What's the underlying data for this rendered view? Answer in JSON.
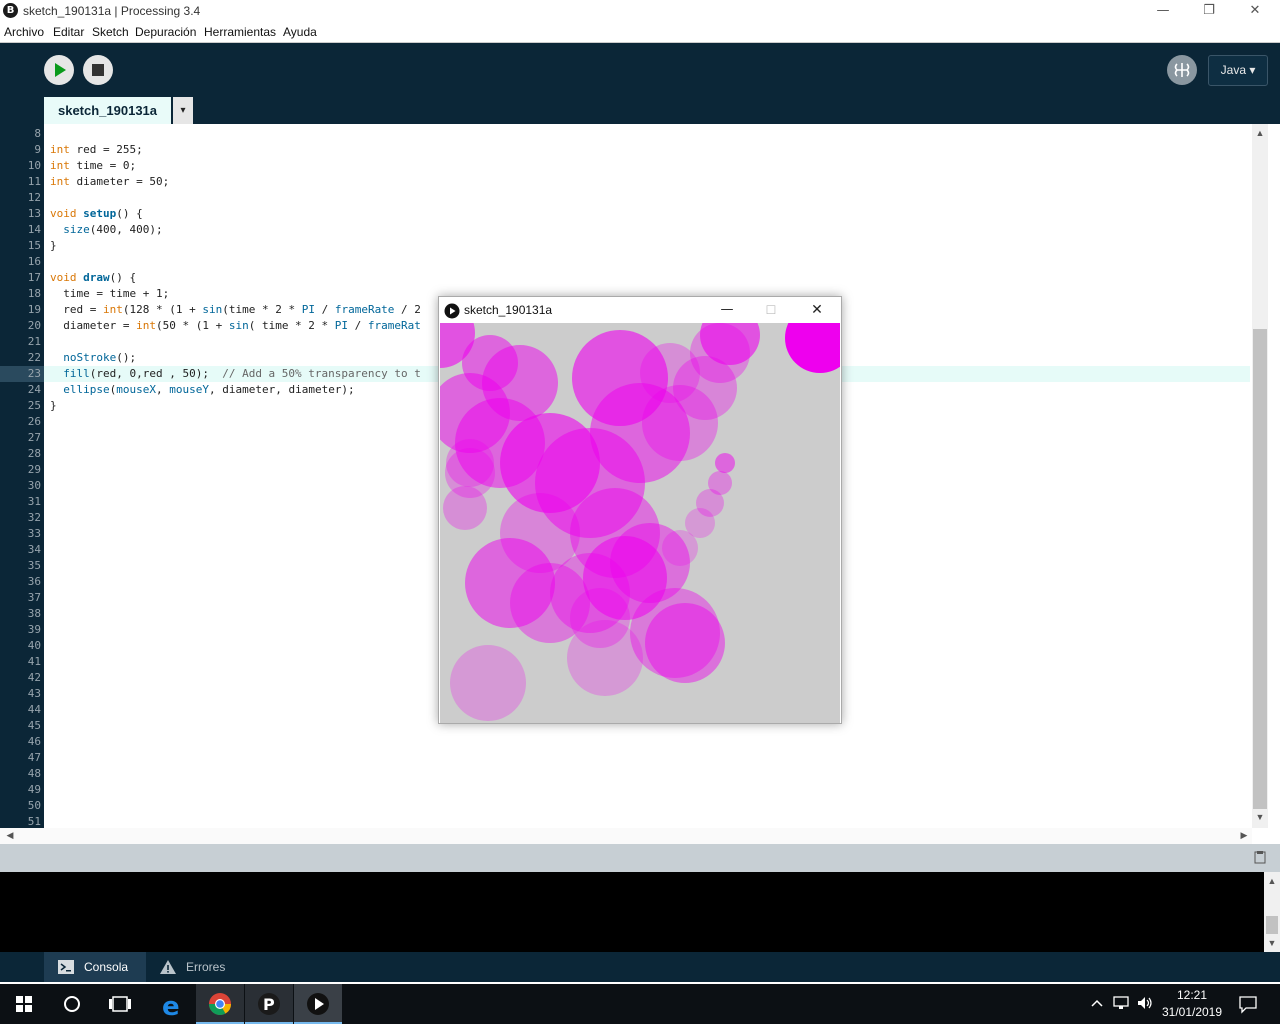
{
  "window": {
    "title": "sketch_190131a | Processing 3.4",
    "app_icon_glyph": "B"
  },
  "menu": {
    "items": [
      "Archivo",
      "Editar",
      "Sketch",
      "Depuración",
      "Herramientas",
      "Ayuda"
    ]
  },
  "toolbar": {
    "run_icon": "play-icon",
    "stop_icon": "stop-icon",
    "debug_icon": "butterfly-icon",
    "mode_label": "Java ▾"
  },
  "tab": {
    "label": "sketch_190131a",
    "menu_glyph": "▾"
  },
  "editor": {
    "current_line": 23,
    "line_numbers": [
      8,
      9,
      10,
      11,
      12,
      13,
      14,
      15,
      16,
      17,
      18,
      19,
      20,
      21,
      22,
      23,
      24,
      25,
      26,
      27,
      28,
      29,
      30,
      31,
      32,
      33,
      34,
      35,
      36,
      37,
      38,
      39,
      40,
      41,
      42,
      43,
      44,
      45,
      46,
      47,
      48,
      49,
      50,
      51
    ],
    "lines": [
      "",
      "int red = 255;",
      "int time = 0;",
      "int diameter = 50;",
      "",
      "void setup() {",
      "  size(400, 400);",
      "}",
      "",
      "void draw() {",
      "  time = time + 1;",
      "  red = int(128 * (1 + sin(time * 2 * PI / frameRate / 2",
      "  diameter = int(50 * (1 + sin( time * 2 * PI / frameRat",
      "",
      "  noStroke();",
      "  fill(red, 0,red , 50);  // Add a 50% transparency to t",
      "  ellipse(mouseX, mouseY, diameter, diameter);",
      "}"
    ]
  },
  "bottom_tabs": {
    "console": "Consola",
    "errors": "Errores"
  },
  "sketch_window": {
    "title": "sketch_190131a"
  },
  "taskbar": {
    "time": "12:21",
    "date": "31/01/2019"
  },
  "colors": {
    "toolbar_bg": "#0b2637",
    "keyword": "#d97706",
    "function": "#006699",
    "builtin": "#d11c66",
    "comment": "#666666",
    "fill": "#ee00ee"
  }
}
